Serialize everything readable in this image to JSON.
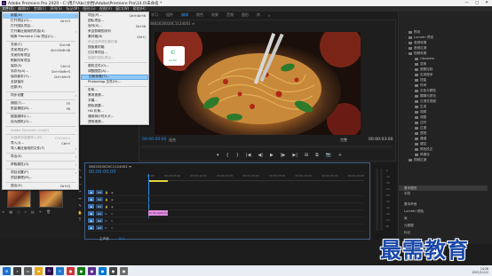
{
  "window": {
    "title": "Adobe Premiere Pro 2020 - C:\\用户\\Abc\\文档\\Adobe\\Premiere Pro\\14.0\\未命名 *",
    "logo_text": "Pr",
    "controls": [
      "—",
      "▢",
      "✕"
    ]
  },
  "menubar": [
    "文件(F)",
    "编辑(E)",
    "剪辑(C)",
    "序列(S)",
    "标记(M)",
    "图形(G)",
    "视图(V)",
    "窗口(W)",
    "帮助(H)"
  ],
  "workspace_tabs": [
    {
      "label": "学习",
      "active": false
    },
    {
      "label": "组件",
      "active": false
    },
    {
      "label": "编辑",
      "active": true
    },
    {
      "label": "颜色",
      "active": false
    },
    {
      "label": "效果",
      "active": false
    },
    {
      "label": "音频",
      "active": false
    },
    {
      "label": "图形",
      "active": false
    },
    {
      "label": "库",
      "active": false
    },
    {
      "label": "»",
      "active": false
    }
  ],
  "file_menu": {
    "items": [
      {
        "label": "新建(N)",
        "shortcut": "",
        "submenu": true,
        "disabled": false,
        "highlighted": true
      },
      {
        "label": "打开项目(O)...",
        "shortcut": "Ctrl+O",
        "submenu": false,
        "disabled": false
      },
      {
        "label": "打开团队项目...",
        "shortcut": "",
        "submenu": false,
        "disabled": false
      },
      {
        "label": "打开最近使用的内容(E)",
        "shortcut": "",
        "submenu": true,
        "disabled": false
      },
      {
        "label": "转换 Premiere Clip 项目(C)...",
        "shortcut": "",
        "submenu": false,
        "disabled": false
      },
      {
        "label": "关闭(C)",
        "shortcut": "Ctrl+W",
        "submenu": false,
        "disabled": false
      },
      {
        "label": "关闭项目(P)",
        "shortcut": "Ctrl+Shift+W",
        "submenu": false,
        "disabled": false
      },
      {
        "label": "关闭所有项目",
        "shortcut": "",
        "submenu": false,
        "disabled": false
      },
      {
        "label": "刷新所有项目",
        "shortcut": "",
        "submenu": false,
        "disabled": false
      },
      {
        "label": "保存(S)",
        "shortcut": "Ctrl+S",
        "submenu": false,
        "disabled": false
      },
      {
        "label": "另存为(A)...",
        "shortcut": "Ctrl+Shift+S",
        "submenu": false,
        "disabled": false
      },
      {
        "label": "保存副本(Y)...",
        "shortcut": "Ctrl+Alt+S",
        "submenu": false,
        "disabled": false
      },
      {
        "label": "全部保存",
        "shortcut": "",
        "submenu": false,
        "disabled": false
      },
      {
        "label": "还原(R)",
        "shortcut": "",
        "submenu": false,
        "disabled": false
      },
      {
        "label": "同步设置",
        "shortcut": "",
        "submenu": true,
        "disabled": false
      },
      {
        "label": "捕捉(T)...",
        "shortcut": "F5",
        "submenu": false,
        "disabled": false
      },
      {
        "label": "批量捕捉(B)...",
        "shortcut": "F6",
        "submenu": false,
        "disabled": false
      },
      {
        "label": "链接媒体(L)...",
        "shortcut": "",
        "submenu": false,
        "disabled": false
      },
      {
        "label": "设为脱机(O)...",
        "shortcut": "",
        "submenu": false,
        "disabled": false
      },
      {
        "label": "Adobe Dynamic Link(K)",
        "shortcut": "",
        "submenu": true,
        "disabled": true
      },
      {
        "label": "从媒体浏览器导入(M)",
        "shortcut": "Ctrl+Alt+I",
        "submenu": false,
        "disabled": true
      },
      {
        "label": "导入(I)...",
        "shortcut": "Ctrl+I",
        "submenu": false,
        "disabled": false
      },
      {
        "label": "导入最近使用的文件(F)",
        "shortcut": "",
        "submenu": true,
        "disabled": false
      },
      {
        "label": "导出(E)",
        "shortcut": "",
        "submenu": true,
        "disabled": false
      },
      {
        "label": "获取属性(G)",
        "shortcut": "",
        "submenu": true,
        "disabled": false
      },
      {
        "label": "项目设置(P)",
        "shortcut": "",
        "submenu": true,
        "disabled": false
      },
      {
        "label": "项目管理(M)...",
        "shortcut": "",
        "submenu": false,
        "disabled": false
      },
      {
        "label": "退出(X)",
        "shortcut": "Ctrl+Q",
        "submenu": false,
        "disabled": false
      }
    ]
  },
  "new_submenu": {
    "items": [
      {
        "label": "项目(P)...",
        "shortcut": "Ctrl+Alt+N",
        "disabled": false
      },
      {
        "label": "团队项目...",
        "shortcut": "",
        "disabled": false
      },
      {
        "label": "序列(S)...",
        "shortcut": "Ctrl+N",
        "disabled": false
      },
      {
        "label": "来自剪辑的序列",
        "shortcut": "",
        "disabled": false
      },
      {
        "label": "素材箱(B)",
        "shortcut": "Ctrl+/",
        "disabled": false
      },
      {
        "label": "来自选择项的素材箱",
        "shortcut": "",
        "disabled": true
      },
      {
        "label": "搜索素材箱",
        "shortcut": "",
        "disabled": false
      },
      {
        "label": "已共享项目...",
        "shortcut": "",
        "disabled": false
      },
      {
        "label": "链接的团队项目...",
        "shortcut": "",
        "disabled": true
      },
      {
        "label": "脱机文件(O)...",
        "shortcut": "",
        "disabled": false
      },
      {
        "label": "调整图层(A)...",
        "shortcut": "",
        "disabled": false
      },
      {
        "label": "旧版标题(T)...",
        "shortcut": "",
        "disabled": false,
        "highlighted": true
      },
      {
        "label": "Photoshop 文件(H)...",
        "shortcut": "",
        "disabled": false
      },
      {
        "label": "彩条...",
        "shortcut": "",
        "disabled": false
      },
      {
        "label": "黑场视频...",
        "shortcut": "",
        "disabled": false
      },
      {
        "label": "字幕...",
        "shortcut": "",
        "disabled": false
      },
      {
        "label": "颜色遮罩...",
        "shortcut": "",
        "disabled": false
      },
      {
        "label": "HD 彩条...",
        "shortcut": "",
        "disabled": false
      },
      {
        "label": "通用倒计时片头...",
        "shortcut": "",
        "disabled": false
      },
      {
        "label": "透明视频...",
        "shortcut": "",
        "disabled": false
      }
    ]
  },
  "monitor": {
    "header": "节目: 0802020020C1124001 ≡",
    "timecode_left": "00:00:00:00",
    "fit": "适合",
    "full": "完整",
    "timecode_right": "00:00:03:00",
    "transport": [
      "▾",
      "{",
      "}",
      "|◀",
      "◀|",
      "▶",
      "|▶",
      "▶|",
      "⊞",
      "⧉",
      "📷",
      "+"
    ]
  },
  "effects_tree": [
    {
      "label": "预设",
      "level": 0,
      "expanded": true
    },
    {
      "label": "Lumetri 预设",
      "level": 0,
      "expanded": true
    },
    {
      "label": "音频效果",
      "level": 0,
      "expanded": false
    },
    {
      "label": "音频过渡",
      "level": 0,
      "expanded": false
    },
    {
      "label": "视频效果",
      "level": 0,
      "expanded": true
    },
    {
      "label": "Obsolete",
      "level": 1
    },
    {
      "label": "变换",
      "level": 1
    },
    {
      "label": "图像控制",
      "level": 1
    },
    {
      "label": "实用程序",
      "level": 1
    },
    {
      "label": "扭曲",
      "level": 1
    },
    {
      "label": "时间",
      "level": 1
    },
    {
      "label": "杂色与颗粒",
      "level": 1
    },
    {
      "label": "模糊与锐化",
      "level": 1
    },
    {
      "label": "沉浸式视频",
      "level": 1
    },
    {
      "label": "生成",
      "level": 1
    },
    {
      "label": "视频",
      "level": 1
    },
    {
      "label": "调整",
      "level": 1
    },
    {
      "label": "过时",
      "level": 1
    },
    {
      "label": "过渡",
      "level": 1
    },
    {
      "label": "透视",
      "level": 1
    },
    {
      "label": "通道",
      "level": 1
    },
    {
      "label": "键控",
      "level": 1
    },
    {
      "label": "颜色校正",
      "level": 1
    },
    {
      "label": "风格化",
      "level": 1
    },
    {
      "label": "视频过渡",
      "level": 0,
      "expanded": false
    }
  ],
  "right_lower": {
    "tabs": [
      "基本图形",
      "浏览"
    ],
    "items": [
      "基本声音",
      "Lumetri 颜色",
      "库",
      "元数据",
      "标记",
      "历史记录",
      "信息"
    ]
  },
  "bin": {
    "tools": [
      "≡",
      "▦",
      "○",
      "⌕",
      "▤",
      "+",
      "🗑"
    ]
  },
  "timeline": {
    "tab_title": "0802020020C1124001 ≡",
    "timecode": "00:00:00:00",
    "ruler_labels": [
      "00:00",
      "00:00:05:00",
      "00:00:10:00",
      "00:00:15:00",
      "00:00:20:00",
      "00:00:25:00",
      "00:00:30:00",
      "00:00:35:00",
      "00:00:40:00"
    ],
    "tracks": [
      "V3",
      "V2",
      "V1",
      "A1",
      "A2",
      "A3"
    ],
    "clip_label": "fx 01.mp4 [V]",
    "master_label": "主声道",
    "master_value": "0.0"
  },
  "meter_labels": [
    "-6",
    "-12",
    "-18",
    "-24",
    "-30",
    "-36",
    "-42",
    "-48",
    "-54",
    "dB"
  ],
  "phone_icon_text": "12:00",
  "taskbar": {
    "time": "14:26",
    "date": "2021/11/12"
  },
  "watermark": "最需教育",
  "colors": {
    "accent_blue": "#2d8ceb",
    "menu_highlight": "#91c9f7",
    "clip_pink": "#e28ee0",
    "watermark_blue": "#1a48a8"
  }
}
